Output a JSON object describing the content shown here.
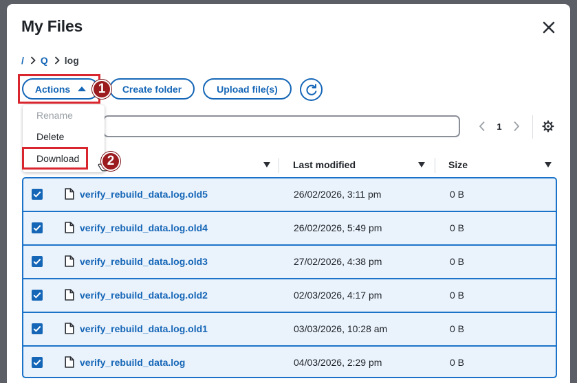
{
  "dialog": {
    "title": "My Files"
  },
  "breadcrumb": {
    "root": "/",
    "items": [
      "Q",
      "log"
    ]
  },
  "toolbar": {
    "actions_label": "Actions",
    "create_folder_label": "Create folder",
    "upload_label": "Upload file(s)"
  },
  "actions_menu": {
    "items": [
      "Rename",
      "Delete",
      "Download"
    ],
    "disabled": [
      "Rename"
    ]
  },
  "pagination": {
    "page": "1"
  },
  "table": {
    "columns": {
      "modified": "Last modified",
      "size": "Size"
    },
    "rows": [
      {
        "name": "verify_rebuild_data.log.old5",
        "modified": "26/02/2026, 3:11 pm",
        "size": "0 B",
        "checked": true
      },
      {
        "name": "verify_rebuild_data.log.old4",
        "modified": "26/02/2026, 5:49 pm",
        "size": "0 B",
        "checked": true
      },
      {
        "name": "verify_rebuild_data.log.old3",
        "modified": "27/02/2026, 4:38 pm",
        "size": "0 B",
        "checked": true
      },
      {
        "name": "verify_rebuild_data.log.old2",
        "modified": "02/03/2026, 4:17 pm",
        "size": "0 B",
        "checked": true
      },
      {
        "name": "verify_rebuild_data.log.old1",
        "modified": "03/03/2026, 10:28 am",
        "size": "0 B",
        "checked": true
      },
      {
        "name": "verify_rebuild_data.log",
        "modified": "04/03/2026, 2:29 pm",
        "size": "0 B",
        "checked": true
      }
    ]
  },
  "annotations": {
    "step1": "1",
    "step2": "2"
  },
  "colors": {
    "accent": "#1566b7",
    "highlight": "#d9262e",
    "badge": "#9b1b1f",
    "row_selected": "#eaf2fb"
  },
  "icons": [
    "close-icon",
    "chevron-right-icon",
    "caret-up-icon",
    "refresh-icon",
    "chevron-left-icon",
    "gear-icon",
    "sort-icon",
    "checkbox-checked-icon",
    "file-icon",
    "hand-pointer-icon"
  ]
}
